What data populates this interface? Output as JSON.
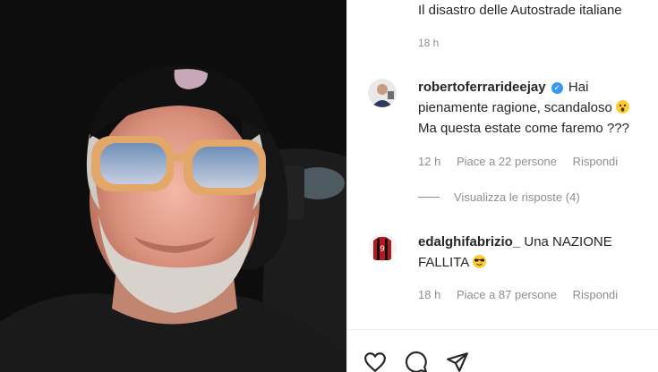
{
  "post": {
    "caption": "Il disastro delle Autostrade italiane",
    "time": "18 h"
  },
  "comments": [
    {
      "username": "robertoferrarideejay",
      "verified": true,
      "text_before_emoji": "Hai pienamente ragione, scandaloso",
      "emoji": "astonished-face",
      "text_after_emoji": " Ma questa estate come faremo ???",
      "time": "12 h",
      "likes": "Piace a 22 persone",
      "reply": "Rispondi"
    },
    {
      "username": "edalghifabrizio_",
      "verified": false,
      "text_before_emoji": "Una NAZIONE FALLITA",
      "emoji": "sunglasses-face",
      "text_after_emoji": "",
      "time": "18 h",
      "likes": "Piace a 87 persone",
      "reply": "Rispondi"
    }
  ],
  "view_replies": "Visualizza le risposte (4)",
  "actions": [
    "like-heart",
    "comment",
    "share-send"
  ],
  "colors": {
    "meta_text": "#8e8e8e",
    "verified": "#3897f0",
    "primary_text": "#262626"
  }
}
